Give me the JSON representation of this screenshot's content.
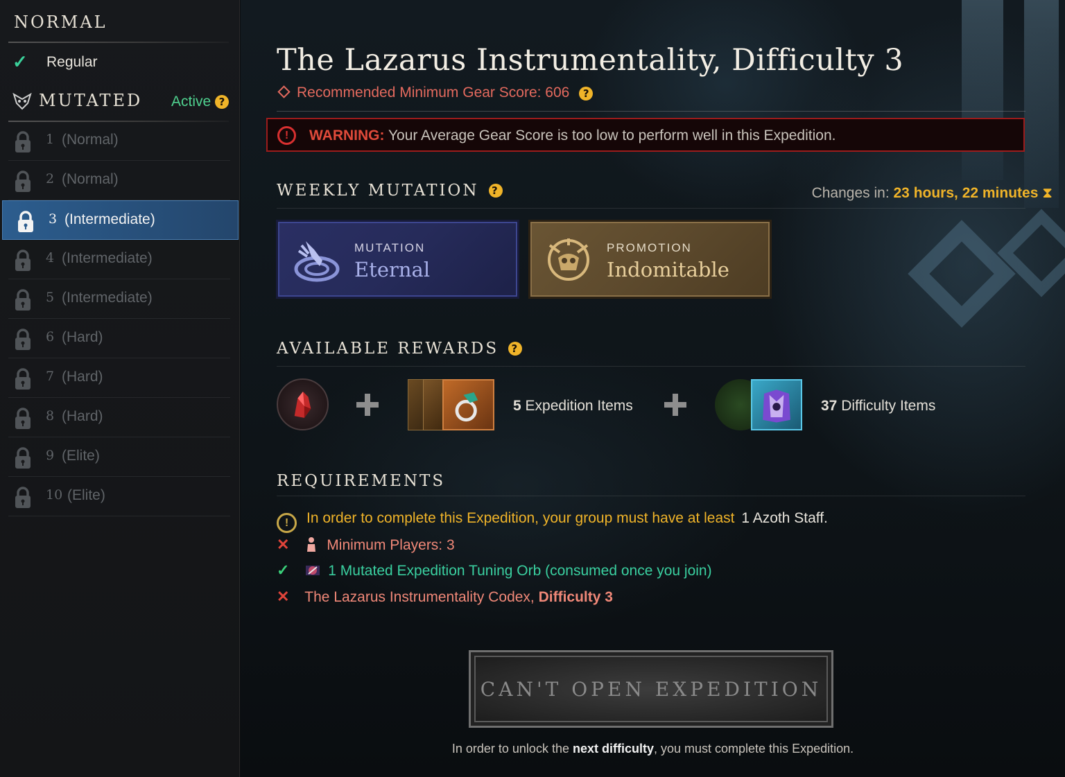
{
  "sidebar": {
    "normal_header": "NORMAL",
    "regular_label": "Regular",
    "mutated_header": "MUTATED",
    "active_label": "Active",
    "levels": [
      {
        "num": "1",
        "label": "(Normal)"
      },
      {
        "num": "2",
        "label": "(Normal)"
      },
      {
        "num": "3",
        "label": "(Intermediate)"
      },
      {
        "num": "4",
        "label": "(Intermediate)"
      },
      {
        "num": "5",
        "label": "(Intermediate)"
      },
      {
        "num": "6",
        "label": "(Hard)"
      },
      {
        "num": "7",
        "label": "(Hard)"
      },
      {
        "num": "8",
        "label": "(Hard)"
      },
      {
        "num": "9",
        "label": "(Elite)"
      },
      {
        "num": "10",
        "label": "(Elite)"
      }
    ],
    "selected_level": "3"
  },
  "header": {
    "title": "The Lazarus Instrumentality, Difficulty 3",
    "recommended": "Recommended Minimum Gear Score: 606"
  },
  "warning": {
    "label": "WARNING:",
    "text": " Your Average Gear Score is too low to perform well in this Expedition."
  },
  "weekly": {
    "heading": "WEEKLY MUTATION",
    "changes_label": "Changes in:",
    "changes_value": "23 hours, 22 minutes",
    "mutation_kind": "MUTATION",
    "mutation_name": "Eternal",
    "promotion_kind": "PROMOTION",
    "promotion_name": "Indomitable"
  },
  "rewards": {
    "heading": "AVAILABLE REWARDS",
    "expedition_count": "5",
    "expedition_label": " Expedition Items",
    "difficulty_count": "37",
    "difficulty_label": " Difficulty Items"
  },
  "requirements": {
    "heading": "REQUIREMENTS",
    "azoth_text": "In order to complete this Expedition, your group must have at least ",
    "azoth_item": "1 Azoth Staff",
    "azoth_end": ".",
    "players": "Minimum Players: 3",
    "orb": "1 Mutated Expedition Tuning Orb (consumed once you join)",
    "codex_text": "The Lazarus Instrumentality Codex, ",
    "codex_bold": "Difficulty 3"
  },
  "button": {
    "label": "CAN'T OPEN EXPEDITION"
  },
  "footer": {
    "pre": "In order to unlock the ",
    "bold": "next difficulty",
    "post": ", you must complete this Expedition."
  },
  "colors": {
    "accent_gold": "#f0b429",
    "warning_red": "#e04a3a",
    "success_green": "#3ad07a",
    "selected_blue": "#2c5d8e"
  },
  "icons": [
    "check-icon",
    "mutated-skull-icon",
    "help-icon",
    "lock-icon",
    "diamond-icon",
    "warning-icon",
    "hourglass-icon",
    "mutation-hand-icon",
    "promotion-skull-icon",
    "plus-icon",
    "person-icon",
    "orb-icon",
    "x-icon"
  ]
}
